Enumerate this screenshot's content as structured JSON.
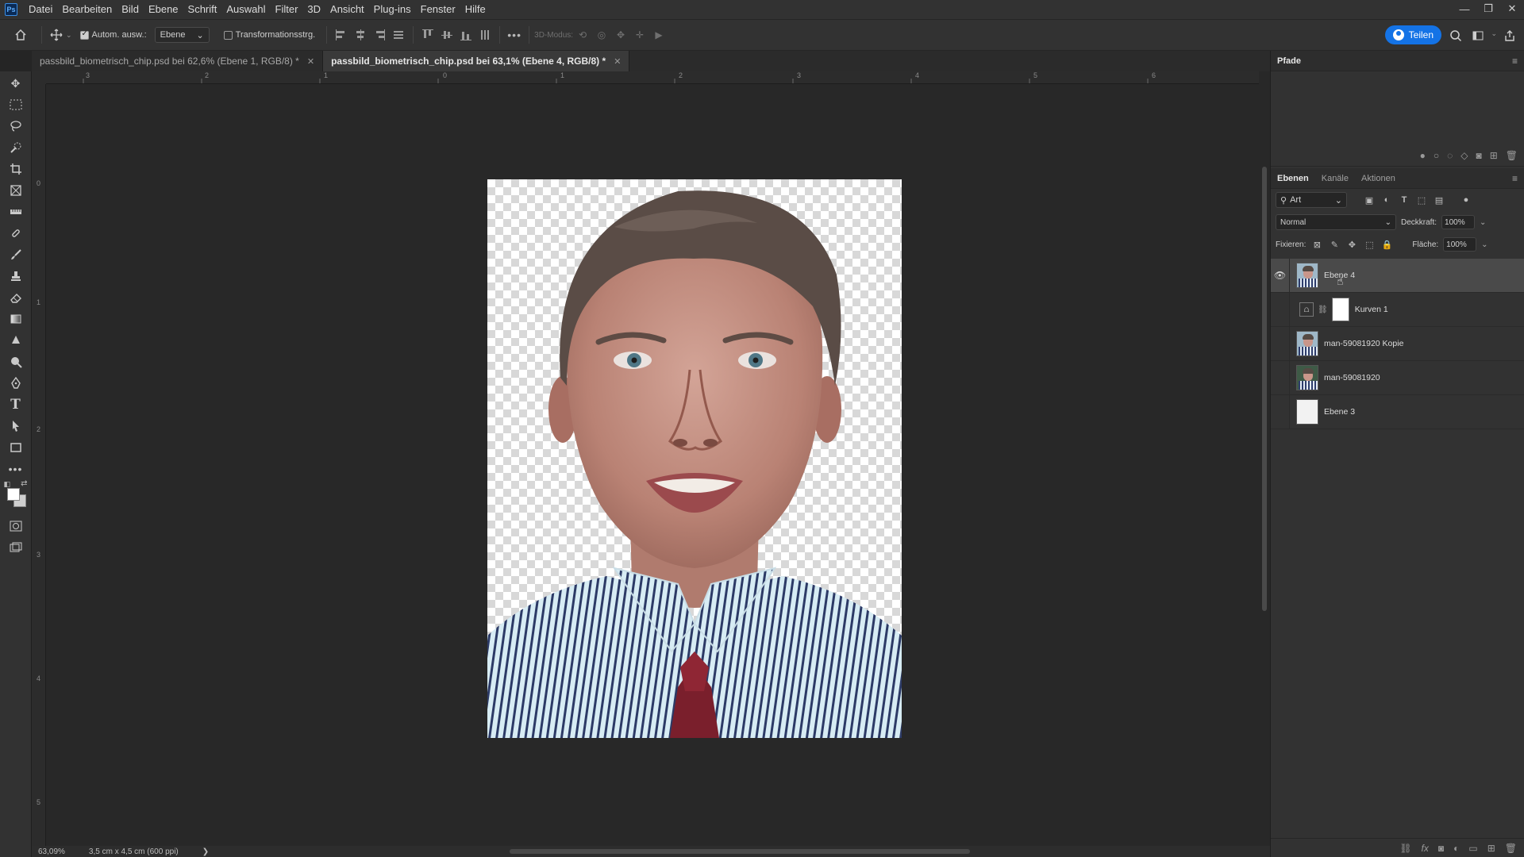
{
  "menu": [
    "Datei",
    "Bearbeiten",
    "Bild",
    "Ebene",
    "Schrift",
    "Auswahl",
    "Filter",
    "3D",
    "Ansicht",
    "Plug-ins",
    "Fenster",
    "Hilfe"
  ],
  "app_logo": "Ps",
  "options": {
    "auto_select_label": "Autom. ausw.:",
    "auto_select_checked": true,
    "auto_select_target": "Ebene",
    "transform_label": "Transformationsstrg.",
    "transform_checked": false,
    "mode_3d_label": "3D-Modus:",
    "more": "•••",
    "share_label": "Teilen"
  },
  "tabs": [
    {
      "label": "passbild_biometrisch_chip.psd bei 62,6% (Ebene 1, RGB/8) *",
      "active": false
    },
    {
      "label": "passbild_biometrisch_chip.psd bei 63,1% (Ebene 4, RGB/8) *",
      "active": true
    }
  ],
  "ruler": {
    "top": [
      "3",
      "2",
      "1",
      "0",
      "1",
      "2",
      "3",
      "4",
      "5",
      "6"
    ],
    "left": [
      "0",
      "1",
      "2",
      "3",
      "4",
      "5"
    ]
  },
  "status": {
    "zoom": "63,09%",
    "doc_size": "3,5 cm x 4,5 cm (600 ppi)",
    "arrow": "❯"
  },
  "panels": {
    "paths_title": "Pfade",
    "layer_tabs": [
      "Ebenen",
      "Kanäle",
      "Aktionen"
    ],
    "filter_kind": "Art",
    "blend_mode": "Normal",
    "opacity_label": "Deckkraft:",
    "opacity_value": "100%",
    "lock_label": "Fixieren:",
    "fill_label": "Fläche:",
    "fill_value": "100%"
  },
  "layers": [
    {
      "name": "Ebene 4",
      "visible": true,
      "selected": true,
      "type": "image"
    },
    {
      "name": "Kurven 1",
      "visible": false,
      "selected": false,
      "type": "adjustment"
    },
    {
      "name": "man-59081920 Kopie",
      "visible": false,
      "selected": false,
      "type": "image"
    },
    {
      "name": "man-59081920",
      "visible": false,
      "selected": false,
      "type": "image"
    },
    {
      "name": "Ebene 3",
      "visible": false,
      "selected": false,
      "type": "blank"
    }
  ],
  "colors": {
    "accent": "#1473e6",
    "foreground": "#ffffff",
    "background": "#cfcfcf"
  }
}
